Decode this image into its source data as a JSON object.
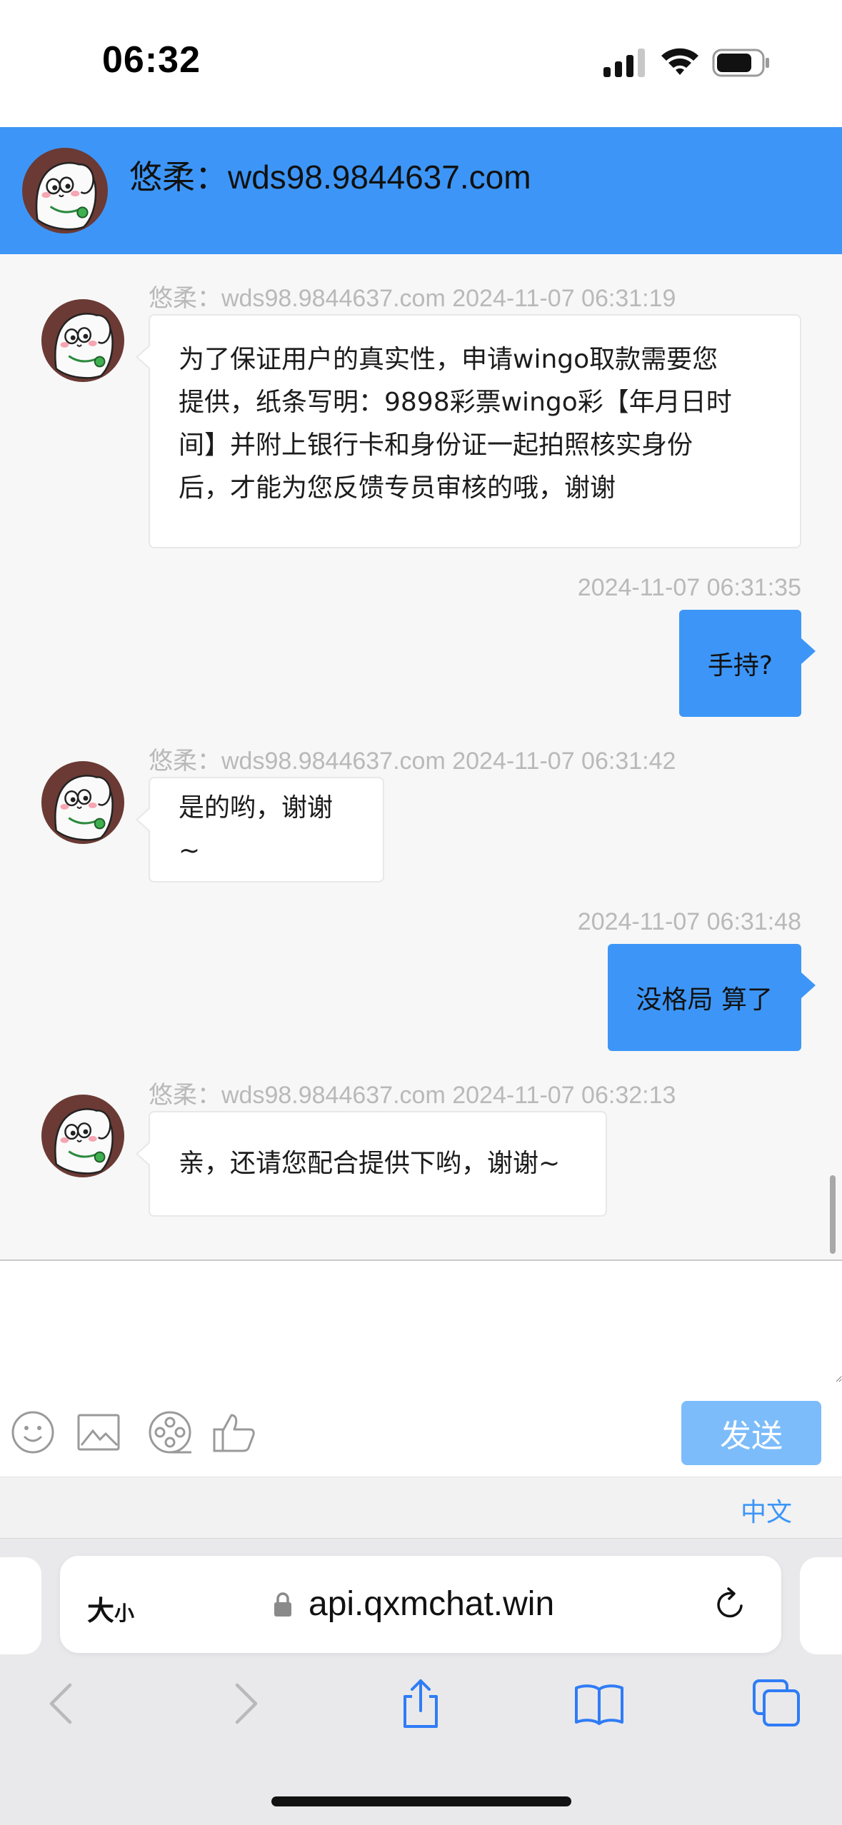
{
  "status_bar": {
    "time": "06:32"
  },
  "header": {
    "title": "悠柔：wds98.9844637.com"
  },
  "messages": [
    {
      "meta": "悠柔：wds98.9844637.com   2024-11-07 06:31:19",
      "lines": [
        "为了保证用户的真实性，申请wingo取款需要您",
        "提供，纸条写明：9898彩票wingo彩【年月日时",
        "间】并附上银行卡和身份证一起拍照核实身份",
        "后，才能为您反馈专员审核的哦，谢谢"
      ]
    },
    {
      "meta": "2024-11-07 06:31:35",
      "text": "手持?"
    },
    {
      "meta": "悠柔：wds98.9844637.com   2024-11-07 06:31:42",
      "text": "是的哟，谢谢~"
    },
    {
      "meta": "2024-11-07 06:31:48",
      "text": "没格局 算了"
    },
    {
      "meta": "悠柔：wds98.9844637.com   2024-11-07 06:32:13",
      "text": "亲，还请您配合提供下哟，谢谢~"
    }
  ],
  "composer": {
    "send_label": "发送",
    "tools": [
      "emoji-icon",
      "image-icon",
      "video-icon",
      "thumbs-up-icon"
    ]
  },
  "language": {
    "label": "中文"
  },
  "browser": {
    "text_size_label_big": "大",
    "text_size_label_small": "小",
    "url": "api.qxmchat.win"
  },
  "colors": {
    "accent": "#3d96f7",
    "send_disabled": "#7cbcfb",
    "meta_text": "#b9b9b9",
    "chat_bg": "#f7f7f7"
  }
}
